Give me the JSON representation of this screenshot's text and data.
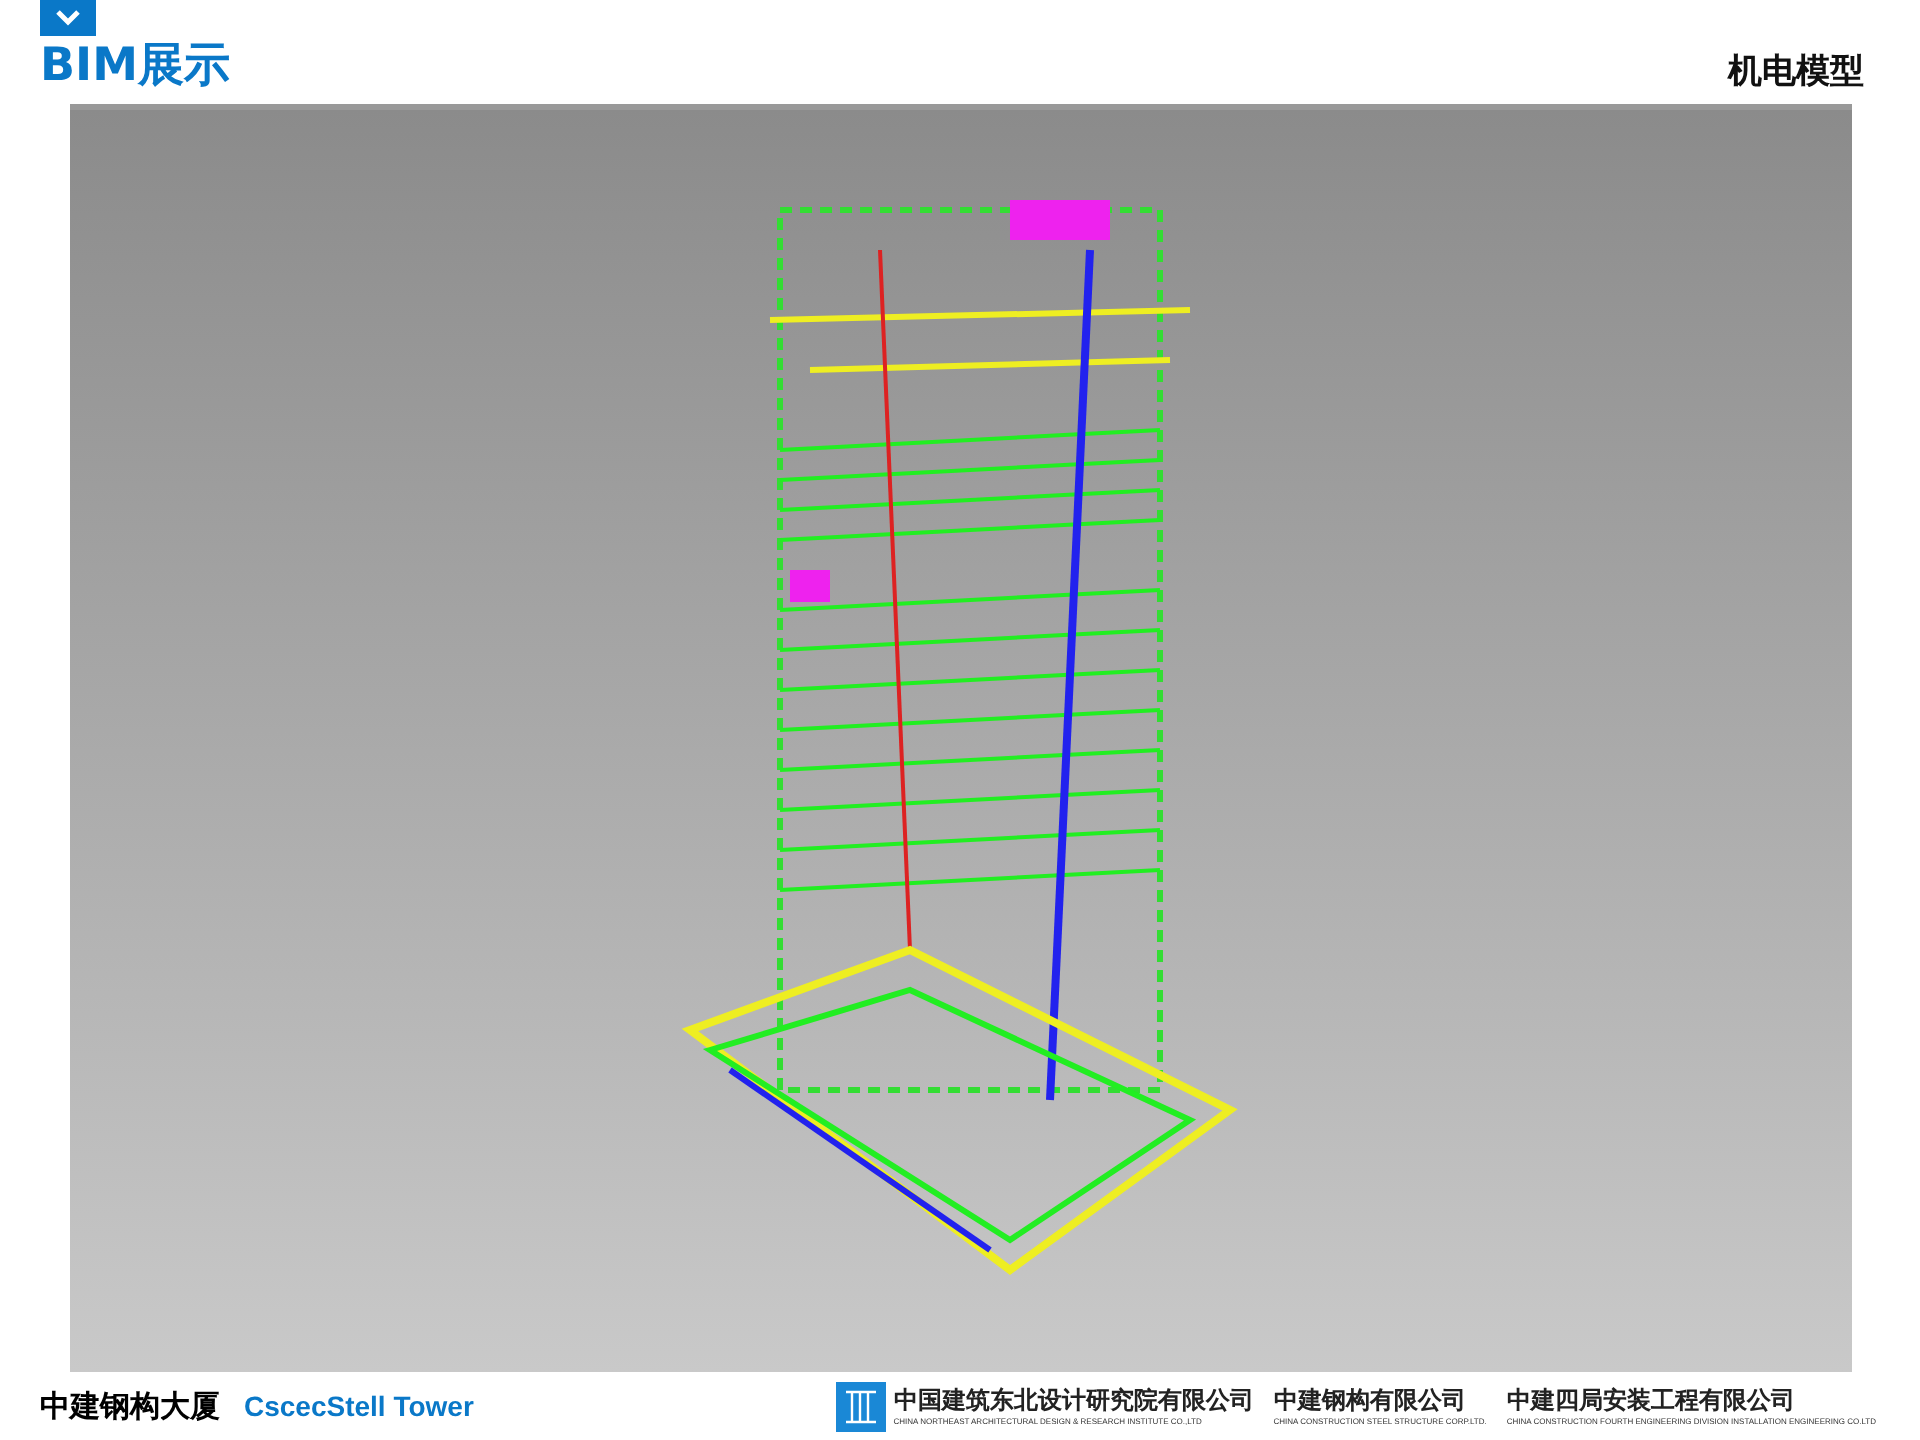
{
  "header": {
    "title": "BIM展示",
    "subtitle": "机电模型"
  },
  "footer": {
    "project_name": "中建钢构大厦",
    "project_name_en": "CscecStell Tower",
    "companies": [
      {
        "name": "中国建筑东北设计研究院有限公司",
        "name_en": "CHINA NORTHEAST ARCHITECTURAL DESIGN & RESEARCH INSTITUTE CO.,LTD",
        "has_logo": true
      },
      {
        "name": "中建钢构有限公司",
        "name_en": "CHINA CONSTRUCTION STEEL STRUCTURE CORP.LTD.",
        "has_logo": false
      },
      {
        "name": "中建四局安装工程有限公司",
        "name_en": "CHINA CONSTRUCTION FOURTH ENGINEERING DIVISION INSTALLATION ENGINEERING CO.LTD",
        "has_logo": false
      }
    ]
  }
}
